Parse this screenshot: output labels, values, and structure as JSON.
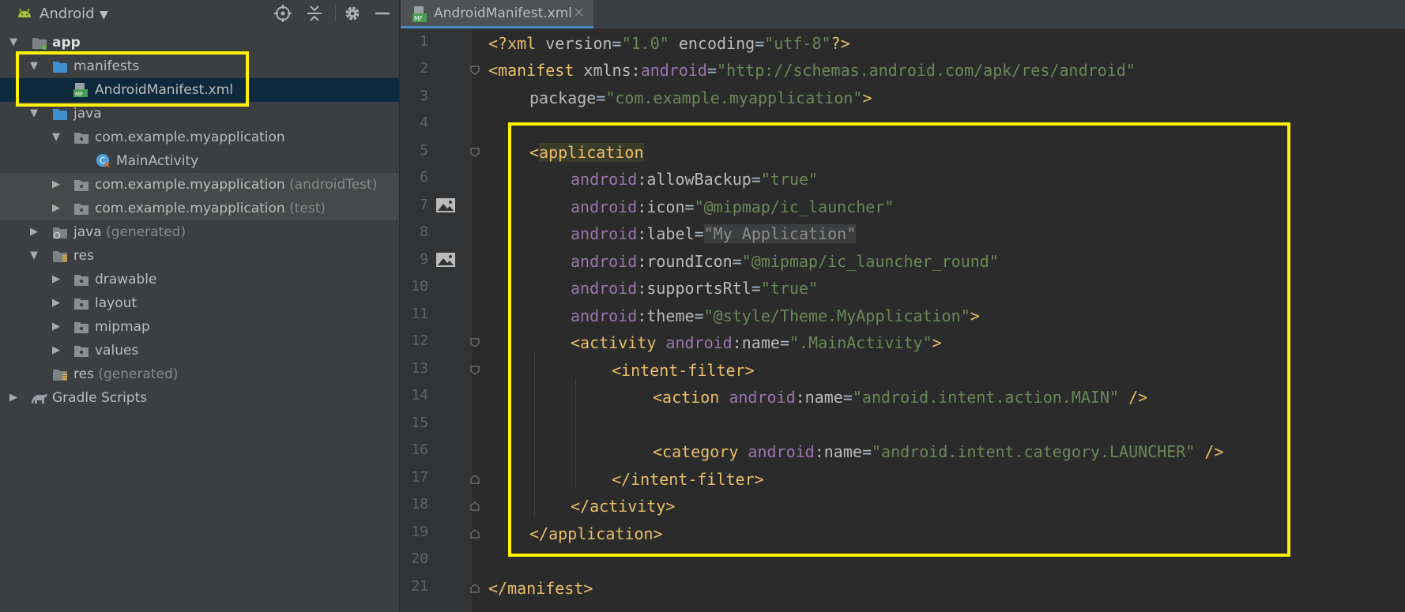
{
  "project_panel": {
    "view_label": "Android",
    "tree": [
      {
        "label": "app",
        "bold": true
      },
      {
        "label": "manifests"
      },
      {
        "label": "AndroidManifest.xml"
      },
      {
        "label": "java"
      },
      {
        "label": "com.example.myapplication"
      },
      {
        "label": "MainActivity"
      },
      {
        "label": "com.example.myapplication",
        "suffix": "(androidTest)"
      },
      {
        "label": "com.example.myapplication",
        "suffix": "(test)"
      },
      {
        "label": "java",
        "suffix": "(generated)"
      },
      {
        "label": "res"
      },
      {
        "label": "drawable"
      },
      {
        "label": "layout"
      },
      {
        "label": "mipmap"
      },
      {
        "label": "values"
      },
      {
        "label": "res",
        "suffix": "(generated)"
      },
      {
        "label": "Gradle Scripts"
      }
    ]
  },
  "editor": {
    "tab_label": "AndroidManifest.xml",
    "tab_close": "×",
    "line_numbers": [
      "1",
      "2",
      "3",
      "4",
      "5",
      "6",
      "7",
      "8",
      "9",
      "10",
      "11",
      "12",
      "13",
      "14",
      "15",
      "16",
      "17",
      "18",
      "19",
      "20",
      "21"
    ],
    "lines": {
      "l1": {
        "a": "<?xml ",
        "b": "version",
        "c": "=",
        "d": "\"1.0\"",
        "e": " encoding",
        "f": "=",
        "g": "\"utf-8\"",
        "h": "?>"
      },
      "l2": {
        "a": "<manifest ",
        "b": "xmlns",
        "c": ":",
        "d": "android",
        "e": "=",
        "f": "\"http://schemas.android.com/apk/res/android\""
      },
      "l3": {
        "a": "package",
        "b": "=",
        "c": "\"com.example.myapplication\"",
        "d": ">"
      },
      "l5": {
        "a": "<",
        "b": "application"
      },
      "l6": {
        "ns": "android",
        "c": ":",
        "attr": "allowBackup",
        "eq": "=",
        "val": "\"true\""
      },
      "l7": {
        "ns": "android",
        "c": ":",
        "attr": "icon",
        "eq": "=",
        "val": "\"@mipmap/ic_launcher\""
      },
      "l8": {
        "ns": "android",
        "c": ":",
        "attr": "label",
        "eq": "=",
        "val": "\"My Application\""
      },
      "l9": {
        "ns": "android",
        "c": ":",
        "attr": "roundIcon",
        "eq": "=",
        "val": "\"@mipmap/ic_launcher_round\""
      },
      "l10": {
        "ns": "android",
        "c": ":",
        "attr": "supportsRtl",
        "eq": "=",
        "val": "\"true\""
      },
      "l11": {
        "ns": "android",
        "c": ":",
        "attr": "theme",
        "eq": "=",
        "val": "\"@style/Theme.MyApplication\"",
        "end": ">"
      },
      "l12": {
        "a": "<activity ",
        "ns": "android",
        "c": ":",
        "attr": "name",
        "eq": "=",
        "val": "\".MainActivity\"",
        "end": ">"
      },
      "l13": {
        "a": "<intent-filter>"
      },
      "l14": {
        "a": "<action ",
        "ns": "android",
        "c": ":",
        "attr": "name",
        "eq": "=",
        "val": "\"android.intent.action.MAIN\"",
        "end": " />"
      },
      "l16": {
        "a": "<category ",
        "ns": "android",
        "c": ":",
        "attr": "name",
        "eq": "=",
        "val": "\"android.intent.category.LAUNCHER\"",
        "end": " />"
      },
      "l17": {
        "a": "</intent-filter>"
      },
      "l18": {
        "a": "</activity>"
      },
      "l19": {
        "a": "</application>"
      },
      "l21": {
        "a": "</manifest>"
      }
    }
  },
  "colors": {
    "panel_bg": "#3c3f41",
    "editor_bg": "#2b2b2b",
    "selection": "#0d293e",
    "highlight_box": "#fff200",
    "xml_tag": "#e8bf6a",
    "xml_namespace": "#9876aa",
    "xml_value": "#6a8759"
  },
  "icons": [
    "android-logo-icon",
    "target-icon",
    "collapse-icon",
    "gear-icon",
    "minimize-icon",
    "folder-icon",
    "manifest-file-icon",
    "package-icon",
    "class-icon",
    "resource-folder-icon",
    "gradle-icon",
    "image-preview-icon",
    "fold-marker-icon"
  ]
}
